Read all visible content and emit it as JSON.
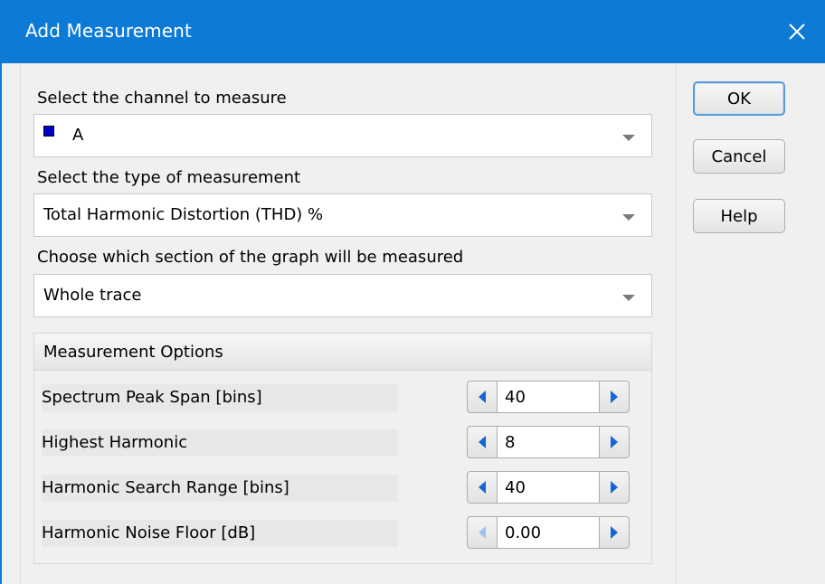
{
  "window": {
    "title": "Add Measurement",
    "close_icon": "close-icon"
  },
  "channel": {
    "label": "Select the channel to measure",
    "value": "A",
    "swatch_color": "#0000cc"
  },
  "measurement_type": {
    "label": "Select the type of measurement",
    "value": "Total Harmonic Distortion (THD) %"
  },
  "section": {
    "label": "Choose which section of the graph will be measured",
    "value": "Whole trace"
  },
  "options": {
    "header": "Measurement Options",
    "items": [
      {
        "label": "Spectrum Peak Span [bins]",
        "value": "40"
      },
      {
        "label": "Highest Harmonic",
        "value": "8"
      },
      {
        "label": "Harmonic Search Range [bins]",
        "value": "40"
      },
      {
        "label": "Harmonic Noise Floor [dB]",
        "value": "0.00"
      }
    ]
  },
  "buttons": {
    "ok": "OK",
    "cancel": "Cancel",
    "help": "Help"
  }
}
